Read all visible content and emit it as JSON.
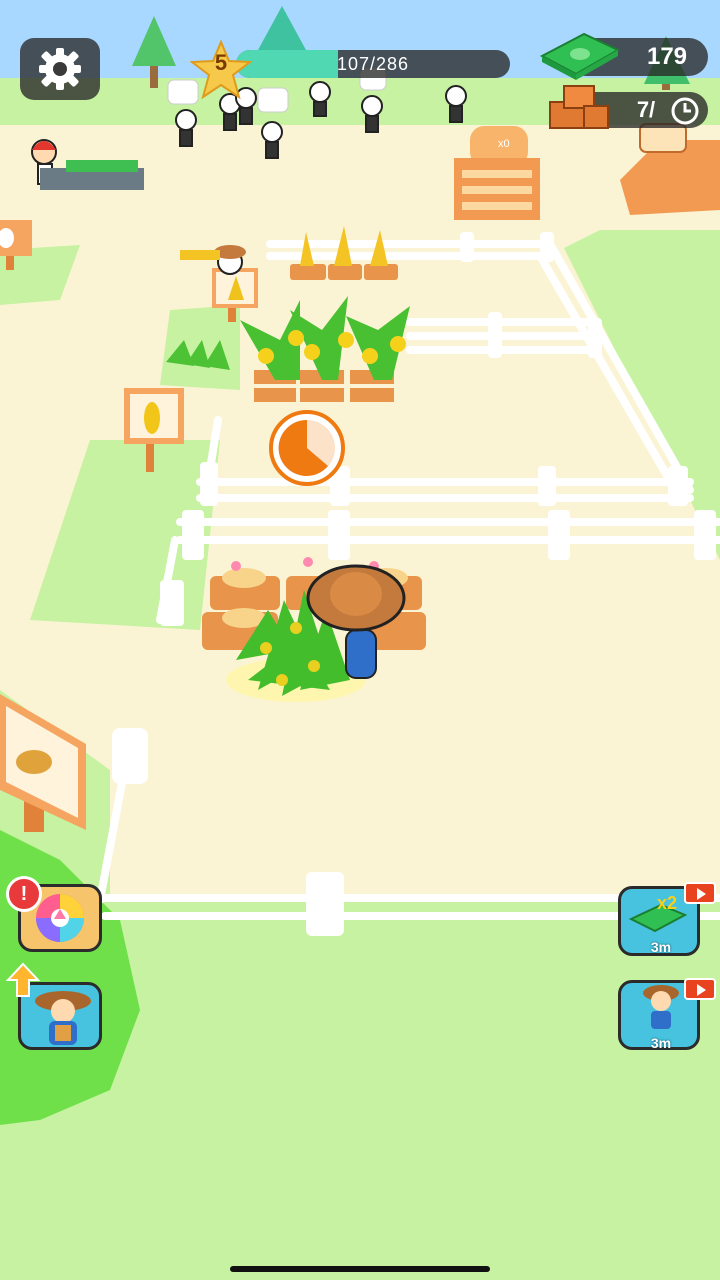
{
  "hud": {
    "level": "5",
    "xp_text": "107/286",
    "xp_progress": 0.374,
    "cash": "179",
    "storage": "7/"
  },
  "boosts": [
    {
      "name": "double-cash-boost",
      "timer": "3m"
    },
    {
      "name": "speed-worker-boost",
      "timer": "3m"
    }
  ],
  "stall": {
    "count": "x0"
  },
  "colors": {
    "grass": "#c6f2a2",
    "field": "#fbf4d4",
    "fence": "#ffffff",
    "soil": "#e8944a",
    "accent_teal": "#4fd8b2",
    "button_teal": "#47c3e0",
    "hud_dark": "#2b2b2b"
  }
}
